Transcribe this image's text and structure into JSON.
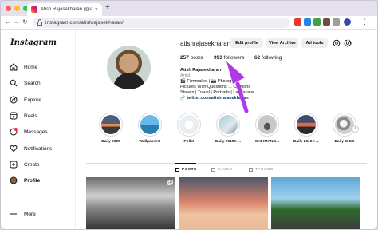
{
  "browser": {
    "tab_title": "Atish Rajasekharan (@atishr",
    "tab_close": "×",
    "new_tab": "+",
    "url": "instagram.com/atishrajasekharan/",
    "nav_back": "←",
    "nav_forward": "→",
    "nav_reload": "↻"
  },
  "sidebar": {
    "logo": "Instagram",
    "items": [
      {
        "label": "Home",
        "icon": "home-icon"
      },
      {
        "label": "Search",
        "icon": "search-icon"
      },
      {
        "label": "Explore",
        "icon": "compass-icon"
      },
      {
        "label": "Reels",
        "icon": "reels-icon"
      },
      {
        "label": "Messages",
        "icon": "messages-icon"
      },
      {
        "label": "Notifications",
        "icon": "heart-icon"
      },
      {
        "label": "Create",
        "icon": "plus-square-icon"
      },
      {
        "label": "Profile",
        "icon": "profile-avatar-icon"
      },
      {
        "label": "More",
        "icon": "menu-icon"
      }
    ],
    "messages_badge": "1"
  },
  "profile": {
    "username": "atishrajasekharan",
    "edit_button": "Edit profile",
    "archive_button": "View Archive",
    "ad_tools_button": "Ad tools",
    "posts_count": "257",
    "posts_label": "posts",
    "followers_count": "993",
    "followers_label": "followers",
    "following_count": "62",
    "following_label": "following",
    "name": "Atish Rajasekharan",
    "category": "Artist",
    "bio_line1": "🎬 Filmmaker | 📷 Photog",
    "bio_line2": "Pictures With Questions ... Captions",
    "bio_line3": "Streets | Travel | Portraits | Landscape",
    "link": "twitter.com/atishrajasekharan"
  },
  "highlights": [
    {
      "label": "Daily 2020"
    },
    {
      "label": "Wallpapers!"
    },
    {
      "label": "Polls!"
    },
    {
      "label": "Daily 2019!! ..."
    },
    {
      "label": "CHIKMANG..."
    },
    {
      "label": "Daily 2019!! ..."
    },
    {
      "label": "Daily 2018!"
    }
  ],
  "highlights_next": "›",
  "post_tabs": {
    "posts": "POSTS",
    "saved": "SAVED",
    "tagged": "TAGGED"
  },
  "colors": {
    "annotation_arrow": "#b238e6",
    "accent_link": "#00376b",
    "badge": "#ff3040"
  }
}
